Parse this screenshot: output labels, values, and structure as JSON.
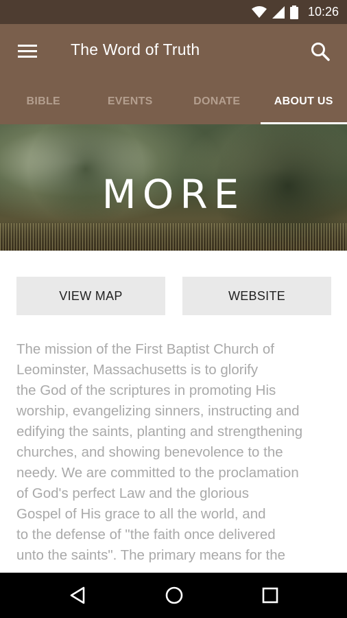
{
  "status_bar": {
    "time": "10:26",
    "icons": [
      "wifi-icon",
      "cell-signal-icon",
      "battery-icon"
    ]
  },
  "app_bar": {
    "title": "The Word of Truth",
    "menu_icon": "menu-icon",
    "search_icon": "search-icon"
  },
  "tabs": [
    {
      "label": "BIBLE",
      "active": false
    },
    {
      "label": "EVENTS",
      "active": false
    },
    {
      "label": "DONATE",
      "active": false
    },
    {
      "label": "ABOUT US",
      "active": true
    }
  ],
  "hero": {
    "title": "MORE"
  },
  "buttons": {
    "view_map": "VIEW MAP",
    "website": "WEBSITE"
  },
  "mission": {
    "text": "The mission of the First Baptist Church of\nLeominster, Massachusetts is to glorify\nthe God of the scriptures in promoting His\nworship, evangelizing sinners, instructing and\nedifying the saints, planting and strengthening\nchurches, and showing benevolence to the\nneedy. We are committed to the proclamation\nof God's perfect Law and the glorious\nGospel of His grace to all the world, and\nto the defense of \"the faith once delivered\nunto the saints\". The primary means for the"
  },
  "nav_bar": {
    "icons": [
      "back-icon",
      "home-icon",
      "recent-apps-icon"
    ]
  },
  "colors": {
    "status_bar": "#4e3d31",
    "app_bar": "#7a5f4c",
    "tab_inactive": "#b49f8f",
    "tab_active": "#ffffff",
    "button_bg": "#e9e9e9",
    "body_text": "#a9a9a9"
  }
}
